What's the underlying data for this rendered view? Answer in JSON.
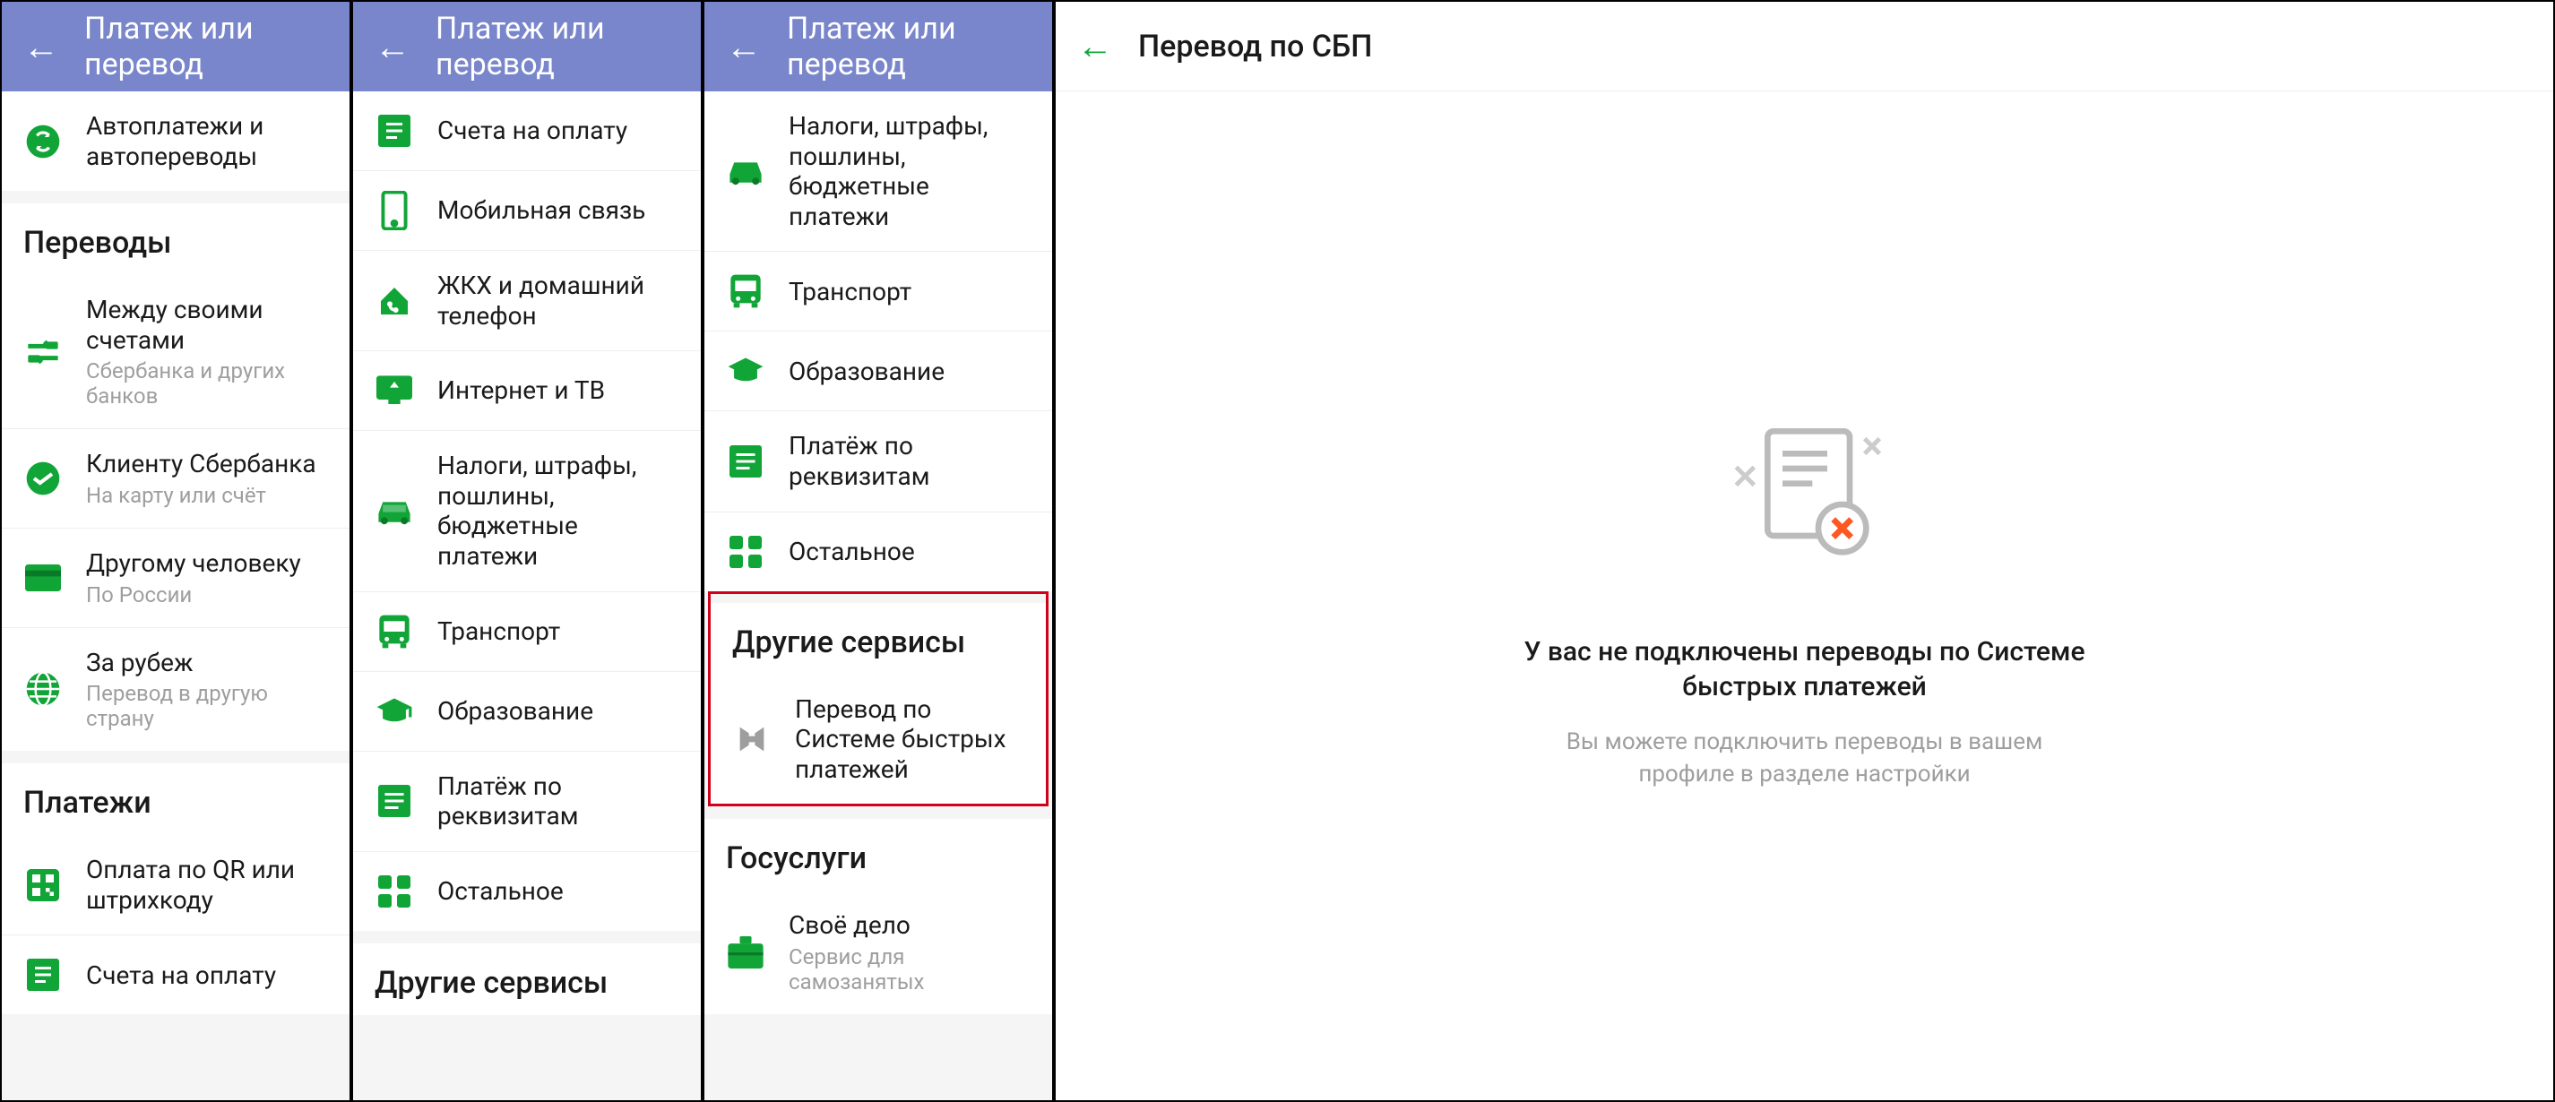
{
  "screen1": {
    "header_title": "Платеж или перевод",
    "top_item": "Автоплатежи и автопереводы",
    "section_transfers": "Переводы",
    "transfers": [
      {
        "title": "Между своими счетами",
        "sub": "Сбербанка и других банков"
      },
      {
        "title": "Клиенту Сбербанка",
        "sub": "На карту или счёт"
      },
      {
        "title": "Другому человеку",
        "sub": "По России"
      },
      {
        "title": "За рубеж",
        "sub": "Перевод в другую страну"
      }
    ],
    "section_payments": "Платежи",
    "payments": [
      {
        "title": "Оплата по QR или штрихкоду"
      },
      {
        "title": "Счета на оплату"
      }
    ]
  },
  "screen2": {
    "header_title": "Платеж или перевод",
    "items": [
      {
        "title": "Счета на оплату"
      },
      {
        "title": "Мобильная связь"
      },
      {
        "title": "ЖКХ и домашний телефон"
      },
      {
        "title": "Интернет и ТВ"
      },
      {
        "title": "Налоги, штрафы, пошлины, бюджетные платежи"
      },
      {
        "title": "Транспорт"
      },
      {
        "title": "Образование"
      },
      {
        "title": "Платёж по реквизитам"
      },
      {
        "title": "Остальное"
      }
    ],
    "section_other": "Другие сервисы"
  },
  "screen3": {
    "header_title": "Платеж или перевод",
    "items_top": [
      {
        "title": "Налоги, штрафы, пошлины, бюджетные платежи"
      },
      {
        "title": "Транспорт"
      },
      {
        "title": "Образование"
      },
      {
        "title": "Платёж по реквизитам"
      },
      {
        "title": "Остальное"
      }
    ],
    "section_other": "Другие сервисы",
    "highlight_item": "Перевод по Системе быстрых платежей",
    "section_gos": "Госуслуги",
    "gos_item": {
      "title": "Своё дело",
      "sub": "Сервис для самозанятых"
    }
  },
  "screen4": {
    "header_title": "Перевод по СБП",
    "empty_title": "У вас не подключены переводы по Системе быстрых платежей",
    "empty_sub": "Вы можете подключить переводы в вашем профиле в разделе настройки"
  }
}
